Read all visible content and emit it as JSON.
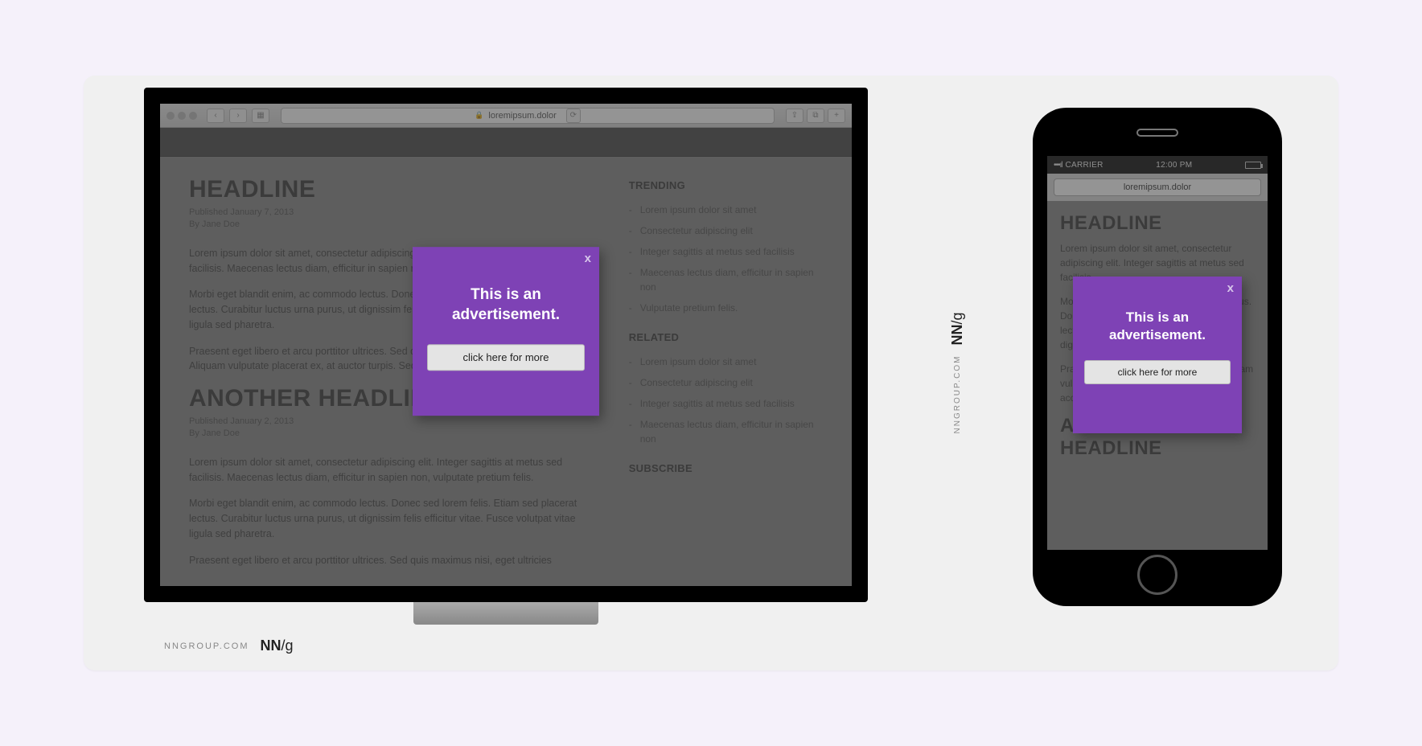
{
  "browser": {
    "url": "loremipsum.dolor"
  },
  "article1": {
    "headline": "HEADLINE",
    "published": "Published January 7, 2013",
    "byline": "By Jane Doe",
    "p1": "Lorem ipsum dolor sit amet, consectetur adipiscing elit. Integer sagittis at metus sed facilisis. Maecenas lectus diam, efficitur in sapien non, vulputate pretium felis.",
    "p2": "Morbi eget blandit enim, ac commodo lectus. Donec sed lorem felis. Etiam sed placerat lectus. Curabitur luctus urna purus, ut dignissim felis efficitur vitae. Fusce volutpat vitae ligula sed pharetra.",
    "p3": "Praesent eget libero et arcu porttitor ultrices. Sed quis maximus nisi, eget ultricies lectus. Aliquam vulputate placerat ex, at auctor turpis. Sed accumsan varius iaculis."
  },
  "article2": {
    "headline": "ANOTHER HEADLINE",
    "published": "Published January 2, 2013",
    "byline": "By Jane Doe",
    "p1": "Lorem ipsum dolor sit amet, consectetur adipiscing elit. Integer sagittis at metus sed facilisis. Maecenas lectus diam, efficitur in sapien non, vulputate pretium felis.",
    "p2": "Morbi eget blandit enim, ac commodo lectus. Donec sed lorem felis. Etiam sed placerat lectus. Curabitur luctus urna purus, ut dignissim felis efficitur vitae. Fusce volutpat vitae ligula sed pharetra.",
    "p3": "Praesent eget libero et arcu porttitor ultrices. Sed quis maximus nisi, eget ultricies"
  },
  "sidebar": {
    "trending_label": "TRENDING",
    "trending": [
      "Lorem ipsum dolor sit amet",
      "Consectetur adipiscing elit",
      "Integer sagittis at metus sed facilisis",
      "Maecenas lectus diam, efficitur in sapien non",
      "Vulputate pretium felis."
    ],
    "related_label": "RELATED",
    "related": [
      "Lorem ipsum dolor sit amet",
      "Consectetur adipiscing elit",
      "Integer sagittis at metus sed facilisis",
      "Maecenas lectus diam, efficitur in sapien non"
    ],
    "subscribe_label": "SUBSCRIBE"
  },
  "ad": {
    "close": "x",
    "text": "This is an advertisement.",
    "cta": "click here for more"
  },
  "mobile": {
    "carrier": "CARRIER",
    "time": "12:00 PM",
    "url": "loremipsum.dolor",
    "headline1": "HEADLINE",
    "p1": "Lorem ipsum dolor sit amet, consectetur adipiscing elit. Integer sagittis at metus sed facilisis.",
    "p2": "Morbi eget blandit enim, ac commodo lectus. Donec sed lorem felis. Etiam sed placerat lectus. Curabitur luctus urna purus, ut dignissim felis efficitur vitae.",
    "p3": "Praesent eget libero et arcu porttitor. Aliquam vulputate placerat ex, at auctor turpis. Sed accumsan varius iaculis.",
    "headline2": "ANOTHER HEADLINE"
  },
  "attribution": {
    "site": "NNGROUP.COM",
    "logo_bold": "NN",
    "logo_slash": "/g"
  }
}
